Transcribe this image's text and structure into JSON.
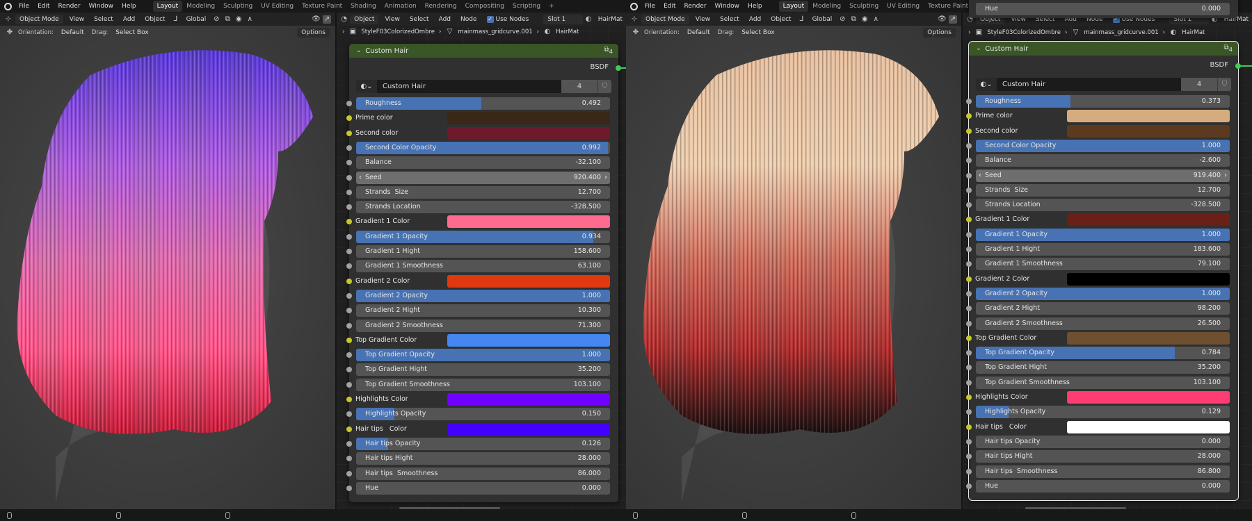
{
  "menu": {
    "items": [
      "File",
      "Edit",
      "Render",
      "Window",
      "Help"
    ],
    "workspaces": [
      "Layout",
      "Modeling",
      "Sculpting",
      "UV Editing",
      "Texture Paint",
      "Shading",
      "Animation",
      "Rendering",
      "Compositing",
      "Scripting",
      "+"
    ],
    "active_workspace": "Layout"
  },
  "viewport_header": {
    "mode": "Object Mode",
    "menus": [
      "View",
      "Select",
      "Add",
      "Object"
    ],
    "transform": "Global",
    "orientation_label": "Orientation:",
    "orientation_value": "Default",
    "drag_label": "Drag:",
    "drag_value": "Select Box",
    "options": "Options"
  },
  "node_header": {
    "type": "Object",
    "menus": [
      "View",
      "Select",
      "Add",
      "Node"
    ],
    "use_nodes": "Use Nodes",
    "slot": "Slot 1",
    "material": "HairMat"
  },
  "breadcrumb": [
    "StyleF03ColorizedOmbre",
    "mainmass_gridcurve.001",
    "HairMat"
  ],
  "halves": [
    {
      "node": {
        "title": "Custom Hair",
        "users_badge": "4",
        "output": "BSDF",
        "group_name": "Custom Hair",
        "group_users": "4",
        "rows": [
          {
            "label": "Roughness",
            "value": "0.492",
            "type": "slider",
            "fill": 0.492
          },
          {
            "label": "Prime color",
            "type": "color",
            "color": "#3a2718"
          },
          {
            "label": "Second color",
            "type": "color",
            "color": "#6e1a2b"
          },
          {
            "label": "Second Color Opacity",
            "value": "0.992",
            "type": "slider",
            "fill": 0.992
          },
          {
            "label": "Balance",
            "value": "-32.100",
            "type": "value"
          },
          {
            "label": "Seed",
            "value": "920.400",
            "type": "seed"
          },
          {
            "label": "Strands  Size",
            "value": "12.700",
            "type": "value"
          },
          {
            "label": "Strands Location",
            "value": "-328.500",
            "type": "value"
          },
          {
            "label": "Gradient 1 Color",
            "type": "color",
            "color": "#ff6b8f"
          },
          {
            "label": "Gradient 1 Opacity",
            "value": "0.934",
            "type": "slider",
            "fill": 0.934
          },
          {
            "label": "Gradient 1 Hight",
            "value": "158.600",
            "type": "value"
          },
          {
            "label": "Gradient 1 Smoothness",
            "value": "63.100",
            "type": "value"
          },
          {
            "label": "Gradient 2 Color",
            "type": "color",
            "color": "#e0380f"
          },
          {
            "label": "Gradient 2 Opacity",
            "value": "1.000",
            "type": "slider",
            "fill": 1.0
          },
          {
            "label": "Gradient 2 Hight",
            "value": "10.300",
            "type": "value"
          },
          {
            "label": "Gradient 2 Smoothness",
            "value": "71.300",
            "type": "value"
          },
          {
            "label": "Top Gradient Color",
            "type": "color",
            "color": "#4487f2"
          },
          {
            "label": "Top Gradient Opacity",
            "value": "1.000",
            "type": "slider",
            "fill": 1.0
          },
          {
            "label": "Top Gradient Hight",
            "value": "35.200",
            "type": "value"
          },
          {
            "label": "Top Gradient Smoothness",
            "value": "103.100",
            "type": "value"
          },
          {
            "label": "Highlights Color",
            "type": "color",
            "color": "#7000ff"
          },
          {
            "label": "Highlights Opacity",
            "value": "0.150",
            "type": "slider",
            "fill": 0.15
          },
          {
            "label": "Hair tips   Color",
            "type": "color",
            "color": "#4400ff"
          },
          {
            "label": "Hair tips Opacity",
            "value": "0.126",
            "type": "slider",
            "fill": 0.126
          },
          {
            "label": "Hair tips Hight",
            "value": "28.000",
            "type": "value"
          },
          {
            "label": "Hair tips  Smoothness",
            "value": "86.000",
            "type": "value"
          },
          {
            "label": "Hue",
            "value": "0.000",
            "type": "value"
          }
        ]
      }
    },
    {
      "node": {
        "title": "Custom Hair",
        "users_badge": "4",
        "output": "BSDF",
        "group_name": "Custom Hair",
        "group_users": "4",
        "rows": [
          {
            "label": "Roughness",
            "value": "0.373",
            "type": "slider",
            "fill": 0.373
          },
          {
            "label": "Prime color",
            "type": "color",
            "color": "#d6ac7f"
          },
          {
            "label": "Second color",
            "type": "color",
            "color": "#5c3a20"
          },
          {
            "label": "Second Color Opacity",
            "value": "1.000",
            "type": "slider",
            "fill": 1.0
          },
          {
            "label": "Balance",
            "value": "-2.600",
            "type": "value"
          },
          {
            "label": "Seed",
            "value": "919.400",
            "type": "seed"
          },
          {
            "label": "Strands  Size",
            "value": "12.700",
            "type": "value"
          },
          {
            "label": "Strands Location",
            "value": "-328.500",
            "type": "value"
          },
          {
            "label": "Gradient 1 Color",
            "type": "color",
            "color": "#6a1f17"
          },
          {
            "label": "Gradient 1 Opacity",
            "value": "1.000",
            "type": "slider",
            "fill": 1.0
          },
          {
            "label": "Gradient 1 Hight",
            "value": "183.600",
            "type": "value"
          },
          {
            "label": "Gradient 1 Smoothness",
            "value": "79.100",
            "type": "value"
          },
          {
            "label": "Gradient 2 Color",
            "type": "color",
            "color": "#000000"
          },
          {
            "label": "Gradient 2 Opacity",
            "value": "1.000",
            "type": "slider",
            "fill": 1.0
          },
          {
            "label": "Gradient 2 Hight",
            "value": "98.200",
            "type": "value"
          },
          {
            "label": "Gradient 2 Smoothness",
            "value": "26.500",
            "type": "value"
          },
          {
            "label": "Top Gradient Color",
            "type": "color",
            "color": "#6e4f2f"
          },
          {
            "label": "Top Gradient Opacity",
            "value": "0.784",
            "type": "slider",
            "fill": 0.784
          },
          {
            "label": "Top Gradient Hight",
            "value": "35.200",
            "type": "value"
          },
          {
            "label": "Top Gradient Smoothness",
            "value": "103.100",
            "type": "value"
          },
          {
            "label": "Highlights Color",
            "type": "color",
            "color": "#ff3d72"
          },
          {
            "label": "Highlights Opacity",
            "value": "0.129",
            "type": "slider",
            "fill": 0.129
          },
          {
            "label": "Hair tips   Color",
            "type": "color",
            "color": "#ffffff"
          },
          {
            "label": "Hair tips Opacity",
            "value": "0.000",
            "type": "slider",
            "fill": 0.0
          },
          {
            "label": "Hair tips Hight",
            "value": "28.000",
            "type": "value"
          },
          {
            "label": "Hair tips  Smoothness",
            "value": "86.800",
            "type": "value"
          },
          {
            "label": "Hue",
            "value": "0.000",
            "type": "value"
          }
        ]
      }
    }
  ],
  "hair_palettes": [
    [
      "#5a3cd8",
      "#b060e0",
      "#e070b0",
      "#ff5a8c",
      "#c8203c"
    ],
    [
      "#e8c0a0",
      "#f0d0b0",
      "#d07060",
      "#b03030",
      "#1a1010"
    ]
  ]
}
